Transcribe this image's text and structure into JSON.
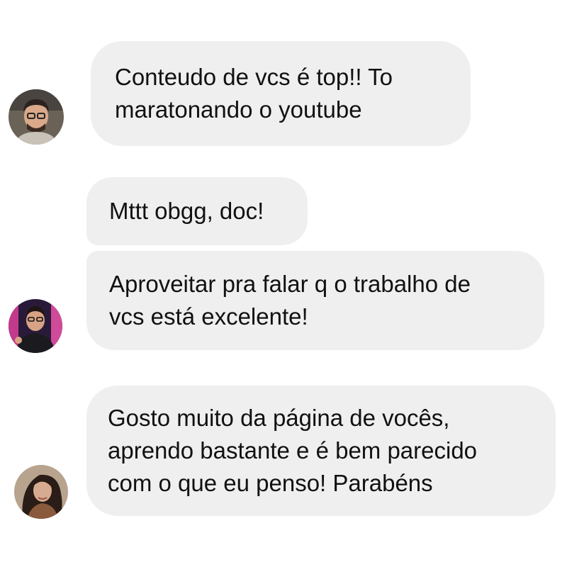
{
  "messages": [
    {
      "lines": [
        "Conteudo de vcs é top!! To",
        "maratonando o youtube"
      ],
      "avatar": "user-avatar-1"
    },
    {
      "lines": [
        "Mttt obgg, doc!"
      ],
      "avatar": "user-avatar-2"
    },
    {
      "lines": [
        "Aproveitar pra falar q o trabalho de",
        "vcs está excelente!"
      ],
      "avatar": "user-avatar-2"
    },
    {
      "lines": [
        "Gosto muito da página de vocês,",
        "aprendo bastante e é bem parecido",
        "com o que eu penso! Parabéns"
      ],
      "avatar": "user-avatar-3"
    }
  ],
  "colors": {
    "bubble_background": "#efefef",
    "text": "#111111",
    "page_background": "#ffffff"
  }
}
